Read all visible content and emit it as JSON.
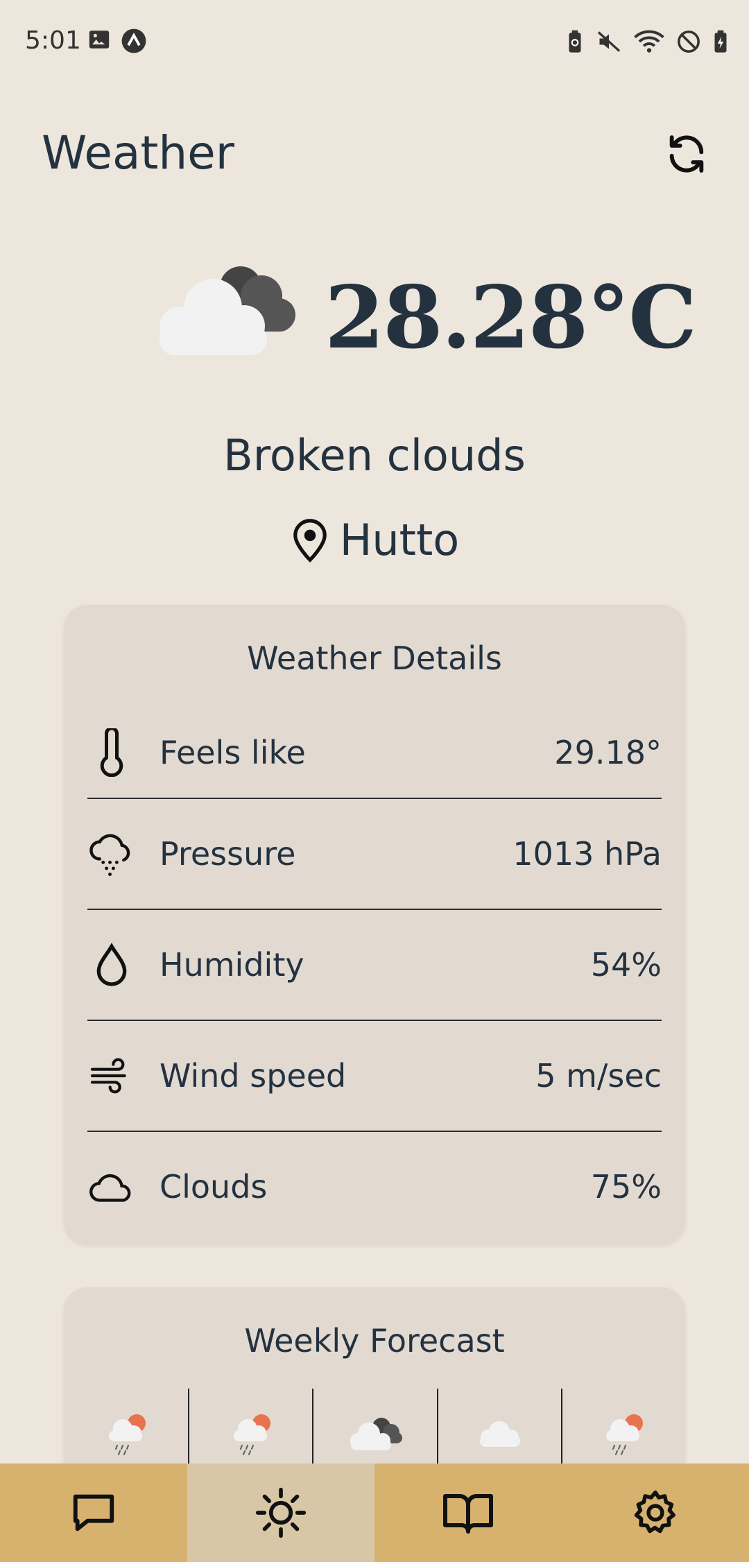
{
  "status_bar": {
    "time": "5:01",
    "left_icons": [
      "image-icon",
      "app-badge-icon"
    ],
    "right_icons": [
      "battery-saver-icon",
      "mute-icon",
      "wifi-icon",
      "dnd-icon",
      "battery-charging-icon"
    ]
  },
  "app_bar": {
    "title": "Weather",
    "refresh_icon": "refresh-icon"
  },
  "current": {
    "icon": "broken-clouds-icon",
    "temperature": "28.28°C",
    "condition": "Broken clouds",
    "location_icon": "map-pin-icon",
    "location": "Hutto"
  },
  "details": {
    "title": "Weather Details",
    "rows": [
      {
        "icon": "thermometer-icon",
        "label": "Feels like",
        "value": "29.18°"
      },
      {
        "icon": "cloud-drizzle-icon",
        "label": "Pressure",
        "value": "1013 hPa"
      },
      {
        "icon": "droplet-icon",
        "label": "Humidity",
        "value": "54%"
      },
      {
        "icon": "wind-icon",
        "label": "Wind speed",
        "value": "5 m/sec"
      },
      {
        "icon": "cloud-icon",
        "label": "Clouds",
        "value": "75%"
      }
    ]
  },
  "forecast": {
    "title": "Weekly Forecast",
    "items": [
      "sun-rain-icon",
      "sun-rain-icon",
      "dark-clouds-icon",
      "cloud-icon",
      "sun-rain-icon"
    ]
  },
  "bottom_nav": {
    "items": [
      {
        "icon": "chat-icon",
        "active": false
      },
      {
        "icon": "sun-icon",
        "active": true
      },
      {
        "icon": "book-icon",
        "active": false
      },
      {
        "icon": "settings-icon",
        "active": false
      }
    ]
  },
  "colors": {
    "background": "#ede6dc",
    "card": "#e2dad1",
    "nav": "#d7b26f",
    "nav_active": "#d8c7a7",
    "text": "#243240"
  }
}
